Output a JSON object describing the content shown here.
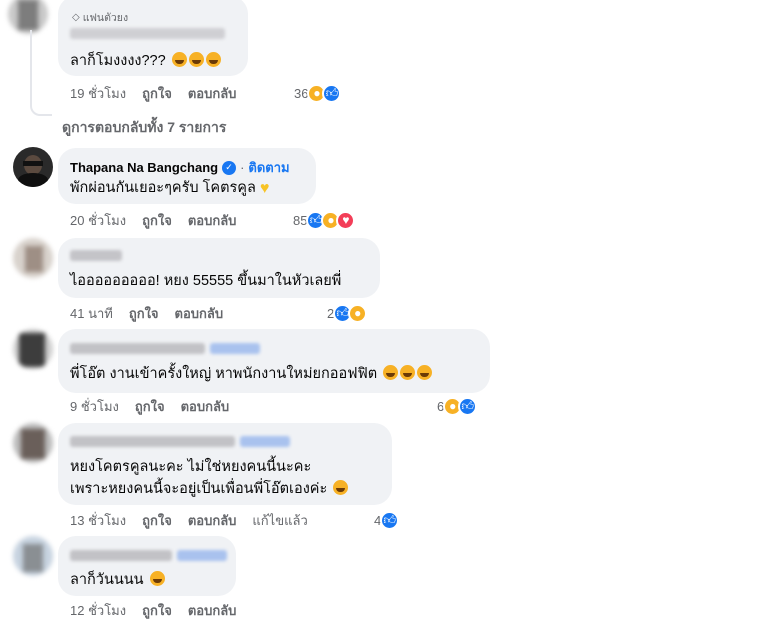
{
  "comments": [
    {
      "badge": "แฟนตัวยง",
      "text": "ลาก็โมงงงง???",
      "time": "19 ชั่วโมง",
      "like": "ถูกใจ",
      "reply": "ตอบกลับ",
      "react_count": "36"
    },
    {
      "view_replies": "ดูการตอบกลับทั้ง 7 รายการ"
    },
    {
      "name": "Thapana Na Bangchang",
      "follow": "ติดตาม",
      "text": "พักผ่อนกันเยอะๆครับ โคตรคูล",
      "time": "20 ชั่วโมง",
      "like": "ถูกใจ",
      "reply": "ตอบกลับ",
      "react_count": "85"
    },
    {
      "text": "ไอออออออออ! หยง 55555 ขึ้นมาในหัวเลยพี่",
      "time": "41 นาที",
      "like": "ถูกใจ",
      "reply": "ตอบกลับ",
      "react_count": "2"
    },
    {
      "text": "พี่โอ๊ต งานเข้าครั้งใหญ่ หาพนักงานใหม่ยกออฟฟิต",
      "time": "9 ชั่วโมง",
      "like": "ถูกใจ",
      "reply": "ตอบกลับ",
      "react_count": "6"
    },
    {
      "text_line1": "หยงโคตรคูลนะคะ ไม่ใช่หยงคนนี้นะคะ",
      "text_line2": "เพราะหยงคนนี้จะอยู่เป็นเพื่อนพี่โอ๊ตเองค่ะ",
      "time": "13 ชั่วโมง",
      "like": "ถูกใจ",
      "reply": "ตอบกลับ",
      "edited": "แก้ไขแล้ว",
      "react_count": "4"
    },
    {
      "text": "ลาก็วันนนน",
      "time": "12 ชั่วโมง",
      "like": "ถูกใจ",
      "reply": "ตอบกลับ"
    }
  ],
  "colors": {
    "bubble": "#f0f2f5",
    "meta": "#65676b",
    "link_blue": "#1877f2",
    "haha": "#f7b125",
    "love": "#f33e58"
  }
}
